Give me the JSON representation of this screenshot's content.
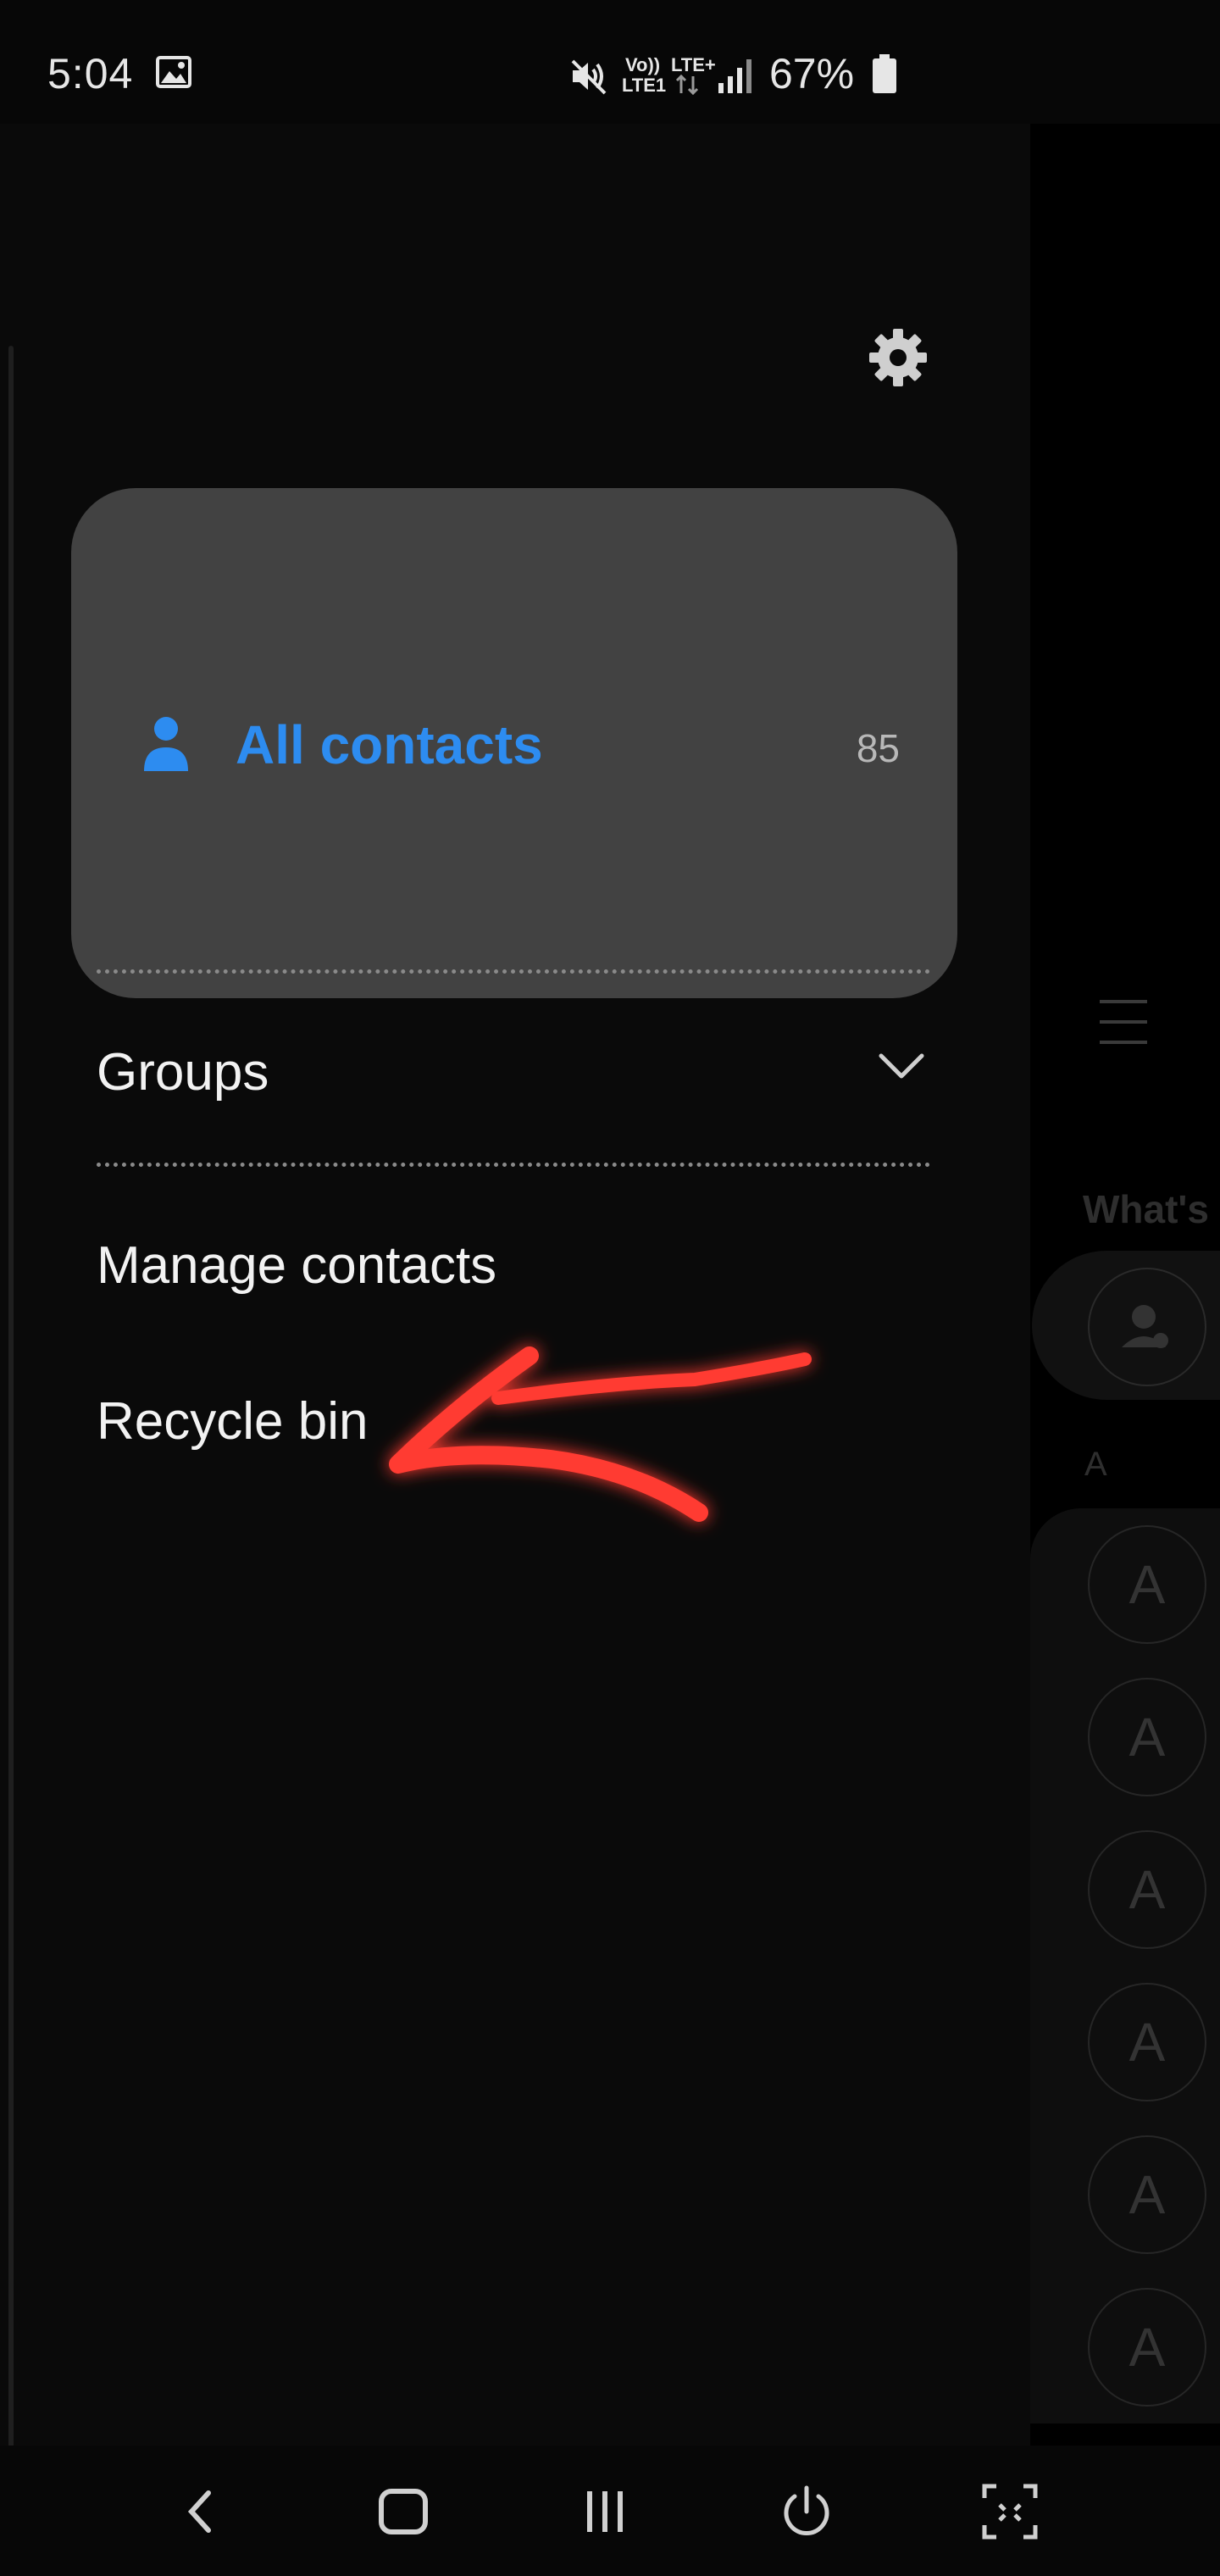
{
  "status_bar": {
    "time": "5:04",
    "network_volte": "Vo))",
    "network_lte1": "LTE1",
    "network_lteplus": "LTE+",
    "battery_percent": "67%",
    "icons": [
      "gallery-icon",
      "mute-icon",
      "signal-icon",
      "battery-icon"
    ]
  },
  "drawer": {
    "settings_icon": "gear-icon",
    "all_contacts": {
      "label": "All contacts",
      "count": "85",
      "icon": "person-icon",
      "accent_color": "#2d8cf0"
    },
    "groups": {
      "label": "Groups",
      "icon": "chevron-down-icon"
    },
    "menu_items": [
      {
        "label": "Manage contacts"
      },
      {
        "label": "Recycle bin"
      }
    ]
  },
  "background_list": {
    "whats_label": "What's",
    "section_letter": "A",
    "avatar_letter": "A",
    "avatar_count": 6
  },
  "annotation": {
    "type": "red-arrow",
    "color": "#ff3b30"
  },
  "nav_bar": {
    "buttons": [
      "back-icon",
      "home-icon",
      "recents-icon",
      "power-icon",
      "screenshot-icon"
    ]
  }
}
